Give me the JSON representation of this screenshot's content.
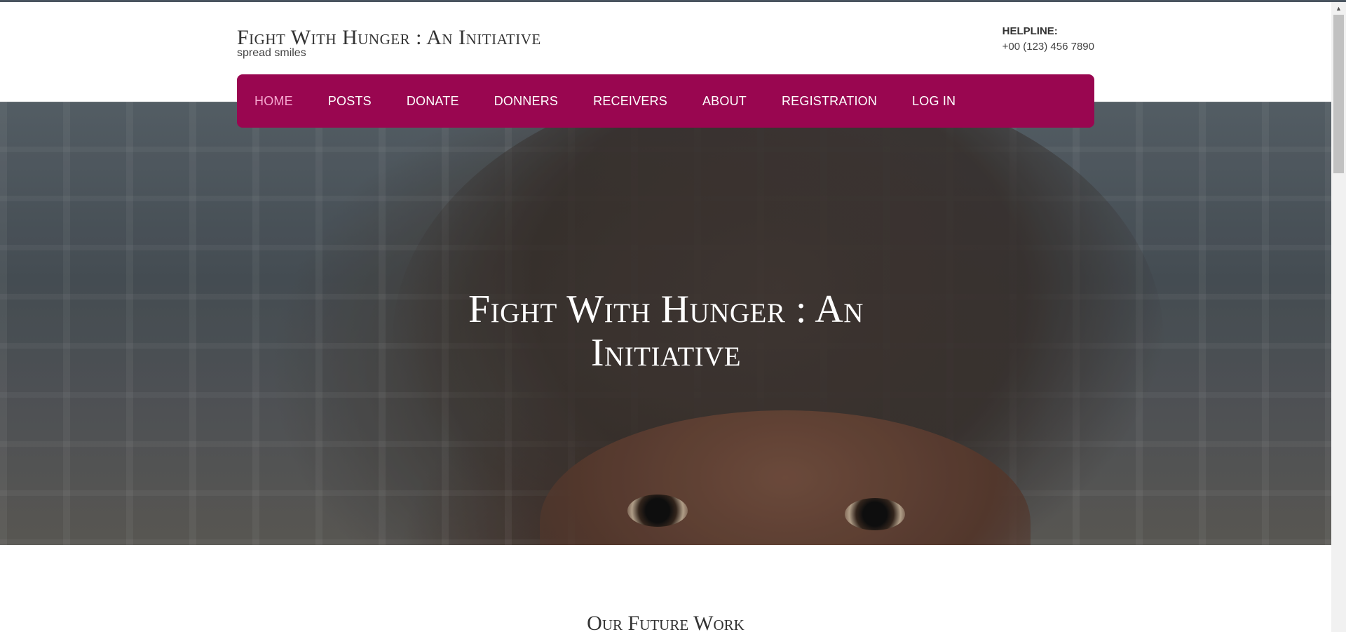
{
  "site": {
    "title": "Fight With Hunger : An Initiative",
    "tagline": "spread smiles"
  },
  "helpline": {
    "label": "HELPLINE:",
    "phone": "+00 (123) 456 7890"
  },
  "nav": {
    "items": [
      {
        "label": "HOME",
        "active": true
      },
      {
        "label": "POSTS"
      },
      {
        "label": "DONATE"
      },
      {
        "label": "DONNERS"
      },
      {
        "label": "RECEIVERS"
      },
      {
        "label": "ABOUT"
      },
      {
        "label": "REGISTRATION"
      },
      {
        "label": "LOG IN"
      }
    ]
  },
  "hero": {
    "title": "Fight With Hunger : An Initiative"
  },
  "section": {
    "title": "Our Future Work"
  },
  "colors": {
    "nav_background": "#990650",
    "nav_active": "#f7a8d0",
    "text_dark": "#333333"
  },
  "icons": {
    "scroll_up": "triangle-up"
  }
}
